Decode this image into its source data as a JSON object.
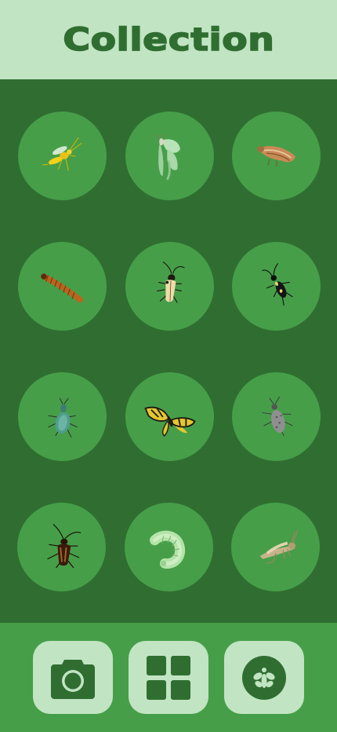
{
  "header": {
    "title": "Collection"
  },
  "collection": {
    "items": [
      {
        "icon": "wasp-icon"
      },
      {
        "icon": "luna-moth-icon"
      },
      {
        "icon": "brown-moth-icon"
      },
      {
        "icon": "mealworm-icon"
      },
      {
        "icon": "longhorn-beetle-icon"
      },
      {
        "icon": "black-beetle-icon"
      },
      {
        "icon": "weevil-icon"
      },
      {
        "icon": "swallowtail-butterfly-icon"
      },
      {
        "icon": "bark-beetle-icon"
      },
      {
        "icon": "cockroach-beetle-icon"
      },
      {
        "icon": "hornworm-caterpillar-icon"
      },
      {
        "icon": "grasshopper-icon"
      }
    ]
  },
  "nav": {
    "items": [
      {
        "icon": "camera-icon"
      },
      {
        "icon": "grid-icon"
      },
      {
        "icon": "bug-icon"
      }
    ]
  },
  "colors": {
    "background": "#2f6e30",
    "header": "#c1e4c3",
    "circle": "#469e49",
    "nav_bar": "#469e49",
    "nav_button": "#c1e4c3",
    "accent": "#2f6e30"
  }
}
